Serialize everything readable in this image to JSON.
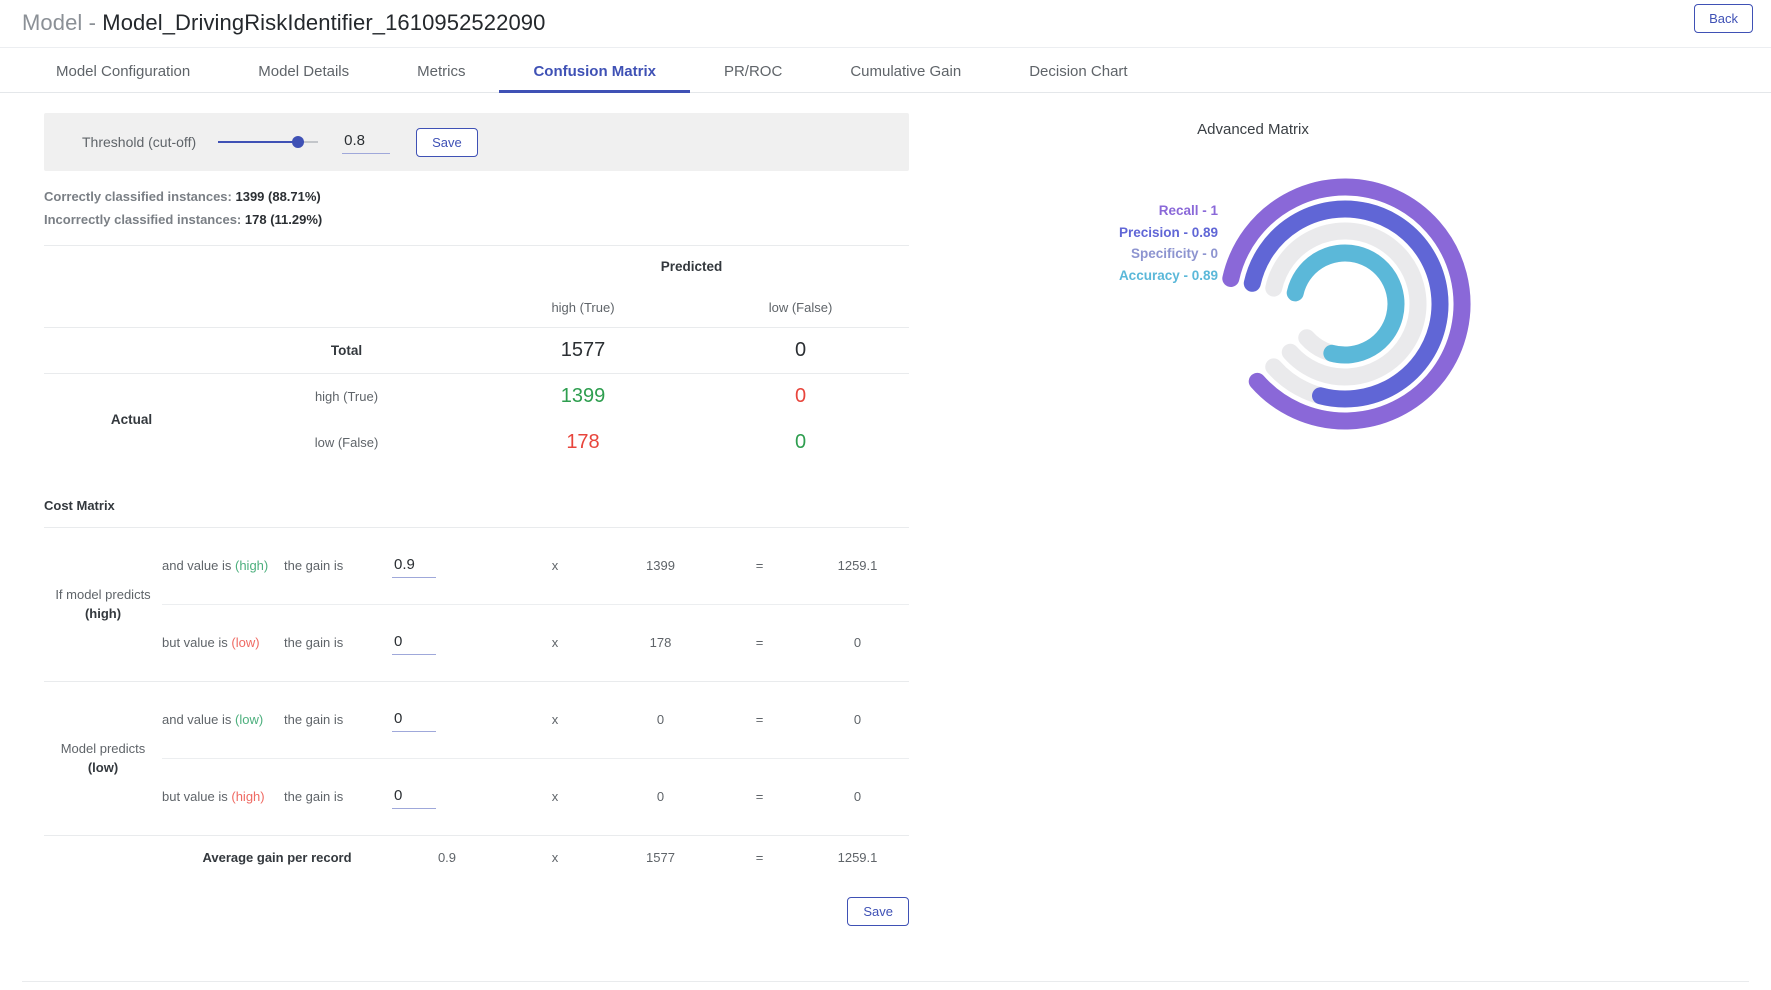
{
  "header": {
    "title_prefix": "Model",
    "title_sep": " - ",
    "title_name": "Model_DrivingRiskIdentifier_1610952522090",
    "back_label": "Back"
  },
  "tabs": [
    {
      "label": "Model Configuration",
      "active": false
    },
    {
      "label": "Model Details",
      "active": false
    },
    {
      "label": "Metrics",
      "active": false
    },
    {
      "label": "Confusion Matrix",
      "active": true
    },
    {
      "label": "PR/ROC",
      "active": false
    },
    {
      "label": "Cumulative Gain",
      "active": false
    },
    {
      "label": "Decision Chart",
      "active": false
    }
  ],
  "threshold": {
    "label": "Threshold (cut-off)",
    "value": "0.8",
    "slider_percent": 80,
    "save_label": "Save"
  },
  "stats": {
    "correct_label": "Correctly classified instances:",
    "correct_value": "1399 (88.71%)",
    "incorrect_label": "Incorrectly classified instances:",
    "incorrect_value": "178 (11.29%)"
  },
  "confusion_matrix": {
    "predicted_header": "Predicted",
    "actual_header": "Actual",
    "col_headers": [
      "high (True)",
      "low (False)"
    ],
    "total_label": "Total",
    "totals": [
      "1577",
      "0"
    ],
    "rows": [
      {
        "label": "high (True)",
        "cells": [
          {
            "value": "1399",
            "color": "green"
          },
          {
            "value": "0",
            "color": "red"
          }
        ]
      },
      {
        "label": "low (False)",
        "cells": [
          {
            "value": "178",
            "color": "red"
          },
          {
            "value": "0",
            "color": "green"
          }
        ]
      }
    ]
  },
  "cost_matrix": {
    "title": "Cost Matrix",
    "groups": [
      {
        "label_line1": "If model predicts",
        "label_line2": "(high)",
        "rows": [
          {
            "cond_prefix": "and value is ",
            "cond_value": "(high)",
            "cond_color": "green",
            "gain_label": "the gain is",
            "gain": "0.9",
            "mult": "x",
            "count": "1399",
            "eq": "=",
            "result": "1259.1"
          },
          {
            "cond_prefix": "but value is ",
            "cond_value": "(low)",
            "cond_color": "red",
            "gain_label": "the gain is",
            "gain": "0",
            "mult": "x",
            "count": "178",
            "eq": "=",
            "result": "0"
          }
        ]
      },
      {
        "label_line1": "Model predicts",
        "label_line2": "(low)",
        "rows": [
          {
            "cond_prefix": "and value is ",
            "cond_value": "(low)",
            "cond_color": "green",
            "gain_label": "the gain is",
            "gain": "0",
            "mult": "x",
            "count": "0",
            "eq": "=",
            "result": "0"
          },
          {
            "cond_prefix": "but value is ",
            "cond_value": "(high)",
            "cond_color": "red",
            "gain_label": "the gain is",
            "gain": "0",
            "mult": "x",
            "count": "0",
            "eq": "=",
            "result": "0"
          }
        ]
      }
    ],
    "average": {
      "label": "Average gain per record",
      "gain": "0.9",
      "mult": "x",
      "count": "1577",
      "eq": "=",
      "result": "1259.1"
    },
    "save_label": "Save"
  },
  "advanced_matrix": {
    "title": "Advanced Matrix",
    "legend": [
      {
        "label": "Recall - 1",
        "value": 1,
        "color": "#8a68d8"
      },
      {
        "label": "Precision - 0.89",
        "value": 0.89,
        "color": "#6066d6"
      },
      {
        "label": "Specificity - 0",
        "value": 0,
        "color": "#8d94d0"
      },
      {
        "label": "Accuracy - 0.89",
        "value": 0.89,
        "color": "#5bb8d9"
      }
    ],
    "track_color": "#eaeaec"
  },
  "chart_data": {
    "type": "radial-bar",
    "title": "Advanced Matrix",
    "categories": [
      "Recall",
      "Precision",
      "Specificity",
      "Accuracy"
    ],
    "values": [
      1,
      0.89,
      0,
      0.89
    ],
    "labels": [
      "Recall - 1",
      "Precision - 0.89",
      "Specificity - 0",
      "Accuracy - 0.89"
    ],
    "colors": [
      "#8a68d8",
      "#6066d6",
      "#8d94d0",
      "#5bb8d9"
    ],
    "track_color": "#eaeaec",
    "value_range": [
      0,
      1
    ],
    "legend_position": "left",
    "grid": false
  }
}
